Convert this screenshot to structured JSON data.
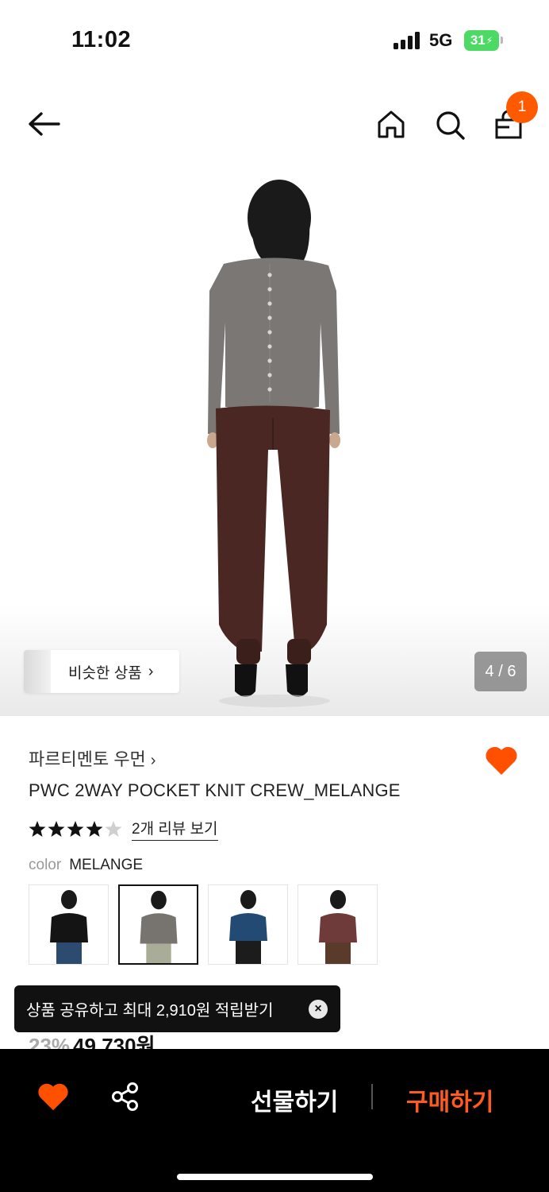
{
  "status_bar": {
    "time": "11:02",
    "network": "5G",
    "battery": "31"
  },
  "nav": {
    "cart_badge": "1"
  },
  "gallery": {
    "similar_label": "비슷한 상품",
    "similar_chevron": "›",
    "page_indicator": "4 / 6"
  },
  "product": {
    "brand": "파르티멘토 우먼",
    "brand_chevron": "›",
    "name": "PWC 2WAY POCKET KNIT CREW_MELANGE",
    "rating": 4.5,
    "review_link": "2개 리뷰 보기",
    "color_label": "color",
    "color_value": "MELANGE",
    "discount": "23%",
    "price": "49,730원"
  },
  "toast": {
    "text": "상품 공유하고 최대 2,910원 적립받기",
    "close": "×"
  },
  "bottom_bar": {
    "gift": "선물하기",
    "buy": "구매하기"
  },
  "colors": {
    "accent": "#ff5a1f",
    "heart": "#ff5000",
    "bottom_bg": "#000000"
  },
  "icons": [
    "back-arrow-icon",
    "home-icon",
    "search-icon",
    "shopping-bag-icon",
    "heart-icon",
    "share-icon",
    "star-icon",
    "close-icon"
  ]
}
